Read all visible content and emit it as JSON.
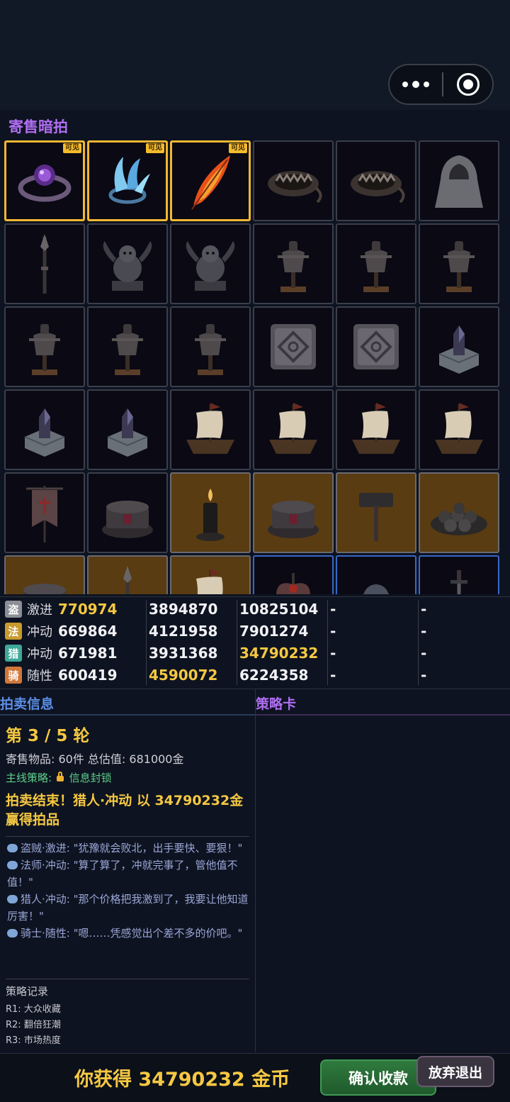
{
  "section_title": "寄售暗拍",
  "visible_badge": "可见",
  "grid_items": [
    {
      "icon": "purple-gem-ring",
      "style": "gold",
      "badge": true
    },
    {
      "icon": "ice-claw-ring",
      "style": "gold",
      "badge": true
    },
    {
      "icon": "fire-feather",
      "style": "gold",
      "badge": true
    },
    {
      "icon": "bear-trap",
      "style": "normal",
      "badge": false
    },
    {
      "icon": "bear-trap",
      "style": "normal",
      "badge": false
    },
    {
      "icon": "hooded-cloak",
      "style": "normal",
      "badge": false
    },
    {
      "icon": "spear",
      "style": "normal",
      "badge": false
    },
    {
      "icon": "gargoyle-statue",
      "style": "normal",
      "badge": false
    },
    {
      "icon": "gargoyle-statue",
      "style": "normal",
      "badge": false
    },
    {
      "icon": "armor-stand",
      "style": "normal",
      "badge": false
    },
    {
      "icon": "armor-stand",
      "style": "normal",
      "badge": false
    },
    {
      "icon": "armor-stand",
      "style": "normal",
      "badge": false
    },
    {
      "icon": "armor-stand",
      "style": "normal",
      "badge": false
    },
    {
      "icon": "armor-stand",
      "style": "normal",
      "badge": false
    },
    {
      "icon": "armor-stand",
      "style": "normal",
      "badge": false
    },
    {
      "icon": "stone-tile",
      "style": "normal",
      "badge": false
    },
    {
      "icon": "stone-tile",
      "style": "normal",
      "badge": false
    },
    {
      "icon": "crystal-pedestal",
      "style": "normal",
      "badge": false
    },
    {
      "icon": "crystal-pedestal",
      "style": "normal",
      "badge": false
    },
    {
      "icon": "crystal-pedestal",
      "style": "normal",
      "badge": false
    },
    {
      "icon": "sailing-ship",
      "style": "normal",
      "badge": false
    },
    {
      "icon": "sailing-ship",
      "style": "normal",
      "badge": false
    },
    {
      "icon": "sailing-ship",
      "style": "normal",
      "badge": false
    },
    {
      "icon": "sailing-ship",
      "style": "normal",
      "badge": false
    },
    {
      "icon": "war-banner",
      "style": "normal",
      "badge": false
    },
    {
      "icon": "stone-altar",
      "style": "normal",
      "badge": false
    },
    {
      "icon": "candle",
      "style": "amber",
      "badge": false
    },
    {
      "icon": "stone-altar",
      "style": "amber",
      "badge": false
    },
    {
      "icon": "war-hammer",
      "style": "amber",
      "badge": false
    },
    {
      "icon": "stone-pile",
      "style": "amber",
      "badge": false
    },
    {
      "icon": "stone-altar",
      "style": "amber",
      "badge": false
    },
    {
      "icon": "spear",
      "style": "amber",
      "badge": false
    },
    {
      "icon": "sailing-ship",
      "style": "amber",
      "badge": false
    },
    {
      "icon": "battle-axe",
      "style": "blue",
      "badge": false
    },
    {
      "icon": "stone-orb",
      "style": "blue",
      "badge": false
    },
    {
      "icon": "sword",
      "style": "blue",
      "badge": false
    }
  ],
  "bid_rows": [
    {
      "role": "盗",
      "role_color": "#8d8f97",
      "personality": "激进",
      "bids": [
        "770974",
        "3894870",
        "10825104",
        "-",
        "-"
      ],
      "highlight": [
        0
      ]
    },
    {
      "role": "法",
      "role_color": "#c99a2e",
      "personality": "冲动",
      "bids": [
        "669864",
        "4121958",
        "7901274",
        "-",
        "-"
      ],
      "highlight": []
    },
    {
      "role": "猎",
      "role_color": "#3fa89a",
      "personality": "冲动",
      "bids": [
        "671981",
        "3931368",
        "34790232",
        "-",
        "-"
      ],
      "highlight": [
        2
      ]
    },
    {
      "role": "骑",
      "role_color": "#d0773a",
      "personality": "随性",
      "bids": [
        "600419",
        "4590072",
        "6224358",
        "-",
        "-"
      ],
      "highlight": [
        1
      ]
    }
  ],
  "auction_info": {
    "title": "拍卖信息",
    "round_text": "第 3 / 5 轮",
    "stock_text": "寄售物品: 60件  总估值: 681000金",
    "strategy_label": "主线策略:",
    "strategy_value": "信息封锁",
    "result_text": "拍卖结束！猎人·冲动 以 34790232金 赢得拍品",
    "chats": [
      "盗贼·激进: \"犹豫就会败北，出手要快、要狠！\"",
      "法师·冲动: \"算了算了，冲就完事了，管他值不值！\"",
      "猎人·冲动: \"那个价格把我激到了，我要让他知道厉害！\"",
      "骑士·随性: \"嗯……凭感觉出个差不多的价吧。\""
    ],
    "record_title": "策略记录",
    "records": [
      "R1: 大众收藏",
      "R2: 翻倍狂潮",
      "R3: 市场热度"
    ]
  },
  "strategy_card": {
    "title": "策略卡"
  },
  "bottom": {
    "earn_text": "你获得 34790232 金币",
    "confirm_label": "确认收款",
    "quit_label": "放弃退出"
  },
  "colors": {
    "gold": "#f5c842",
    "purple": "#b06ef2",
    "blue": "#5b8ee6",
    "green": "#5ed18a"
  }
}
